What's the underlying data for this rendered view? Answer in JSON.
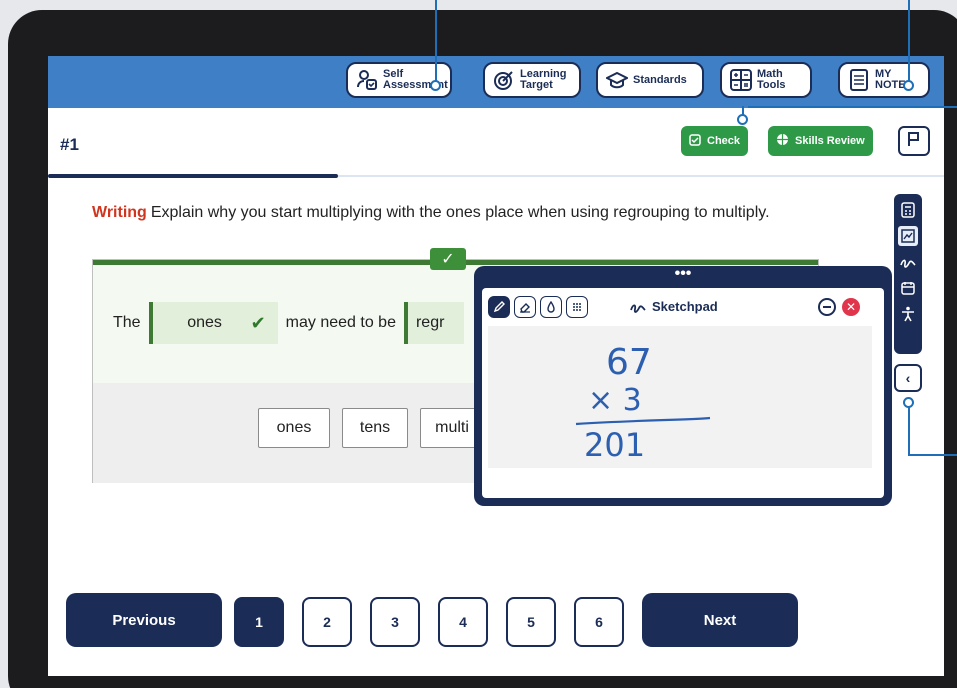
{
  "toolbar": {
    "self_assessment": [
      "Self",
      "Assessment"
    ],
    "learning_target": [
      "Learning",
      "Target"
    ],
    "standards": "Standards",
    "math_tools": [
      "Math",
      "Tools"
    ],
    "my_notes": [
      "MY",
      "NOTES"
    ]
  },
  "question": {
    "number": "#1",
    "check_label": "Check",
    "skills_review_label": "Skills Review",
    "prompt_keyword": "Writing",
    "prompt_text": "Explain why you start multiplying with the ones place when using regrouping to multiply."
  },
  "answer": {
    "sentence_start": "The",
    "blank1_value": "ones",
    "sentence_middle": "may need to be",
    "blank2_value": "regr",
    "word_bank": [
      "ones",
      "tens",
      "multi"
    ]
  },
  "sketchpad": {
    "grip": "•••",
    "title": "Sketchpad",
    "handwriting": [
      "67",
      "× 3",
      "201"
    ]
  },
  "pagination": {
    "previous_label": "Previous",
    "next_label": "Next",
    "pages": [
      "1",
      "2",
      "3",
      "4",
      "5",
      "6"
    ],
    "current_page": "1"
  },
  "colors": {
    "topbar": "#3f7fc6",
    "navy": "#1b2d56",
    "green": "#2e9a48",
    "writing_red": "#d0351f"
  }
}
